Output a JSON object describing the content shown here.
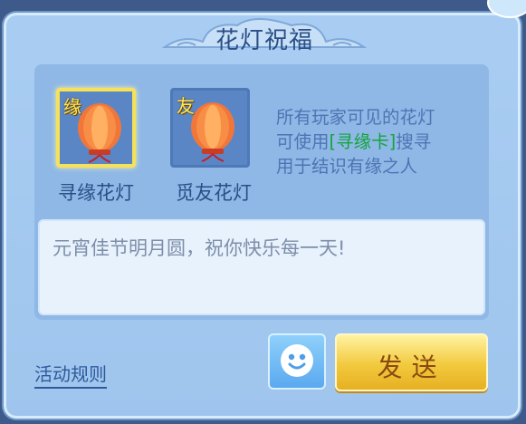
{
  "dialog": {
    "title": "花灯祝福"
  },
  "lanterns": [
    {
      "badge": "缘",
      "label": "寻缘花灯",
      "selected": true
    },
    {
      "badge": "友",
      "label": "觅友花灯",
      "selected": false
    }
  ],
  "description": {
    "line1": "所有玩家可见的花灯",
    "line2_before": "可使用",
    "line2_highlight": "[寻缘卡]",
    "line2_after": "搜寻",
    "line3": "用于结识有缘之人"
  },
  "message": {
    "value": "元宵佳节明月圆，祝你快乐每一天!"
  },
  "footer": {
    "rules_link": "活动规则",
    "send_label": "发送"
  },
  "colors": {
    "panel": "#a9cdf2",
    "highlight": "#15a43c",
    "selected_border": "#f4e25a",
    "send_button": "#f2c93d"
  }
}
